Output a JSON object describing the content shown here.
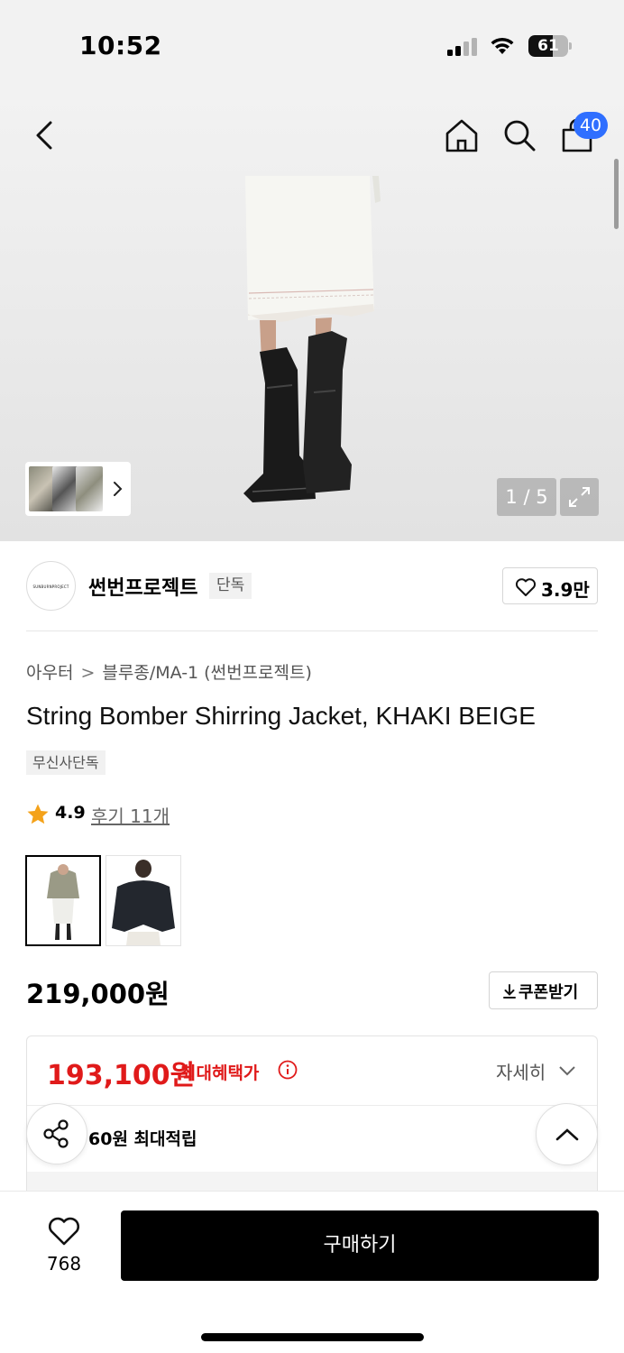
{
  "status_bar": {
    "time": "10:52",
    "battery": "61",
    "battery_level": 0.61
  },
  "nav": {
    "cart_count": "40"
  },
  "gallery": {
    "pager": "1 / 5"
  },
  "brand": {
    "logo_text": "SUNBURNPROJECT",
    "name": "썬번프로젝트",
    "tag": "단독",
    "likes": "3.9만"
  },
  "breadcrumb": {
    "category": "아우터",
    "separator": ">",
    "subcategory": "블루종/MA-1 (썬번프로젝트)"
  },
  "product": {
    "title": "String Bomber Shirring Jacket, KHAKI BEIGE",
    "exclusive_tag": "무신사단독",
    "rating": "4.9",
    "reviews": "후기 11개",
    "price": "219,000원",
    "colors": [
      "khaki-beige",
      "black"
    ]
  },
  "coupon": {
    "label": "쿠폰받기"
  },
  "benefit": {
    "sale_price": "193,100원",
    "sale_label": "최대혜택가",
    "detail_label": "자세히",
    "points": "60원 최대적립"
  },
  "bottom": {
    "wish_count": "768",
    "buy_label": "구매하기"
  },
  "colors": {
    "accent_red": "#e01a1a",
    "badge_blue": "#2f6fff",
    "buy_bg": "#000000"
  }
}
